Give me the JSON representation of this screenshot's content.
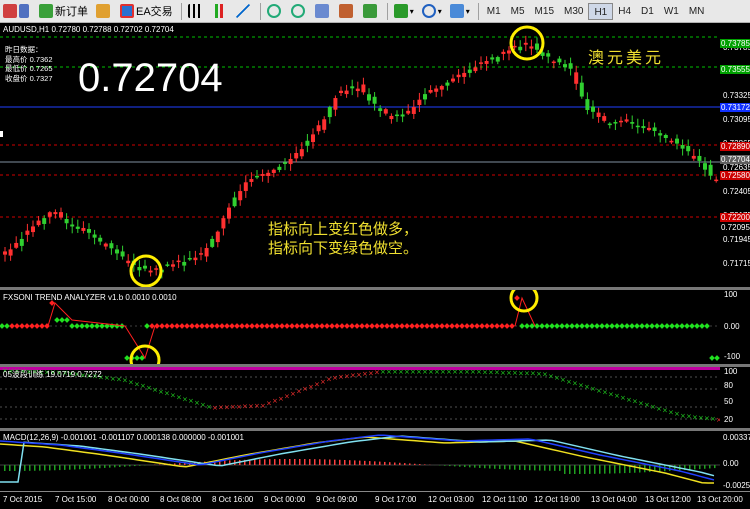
{
  "toolbar": {
    "new_order": "新订单",
    "ea": "EA交易",
    "timeframes": [
      "M1",
      "M5",
      "M15",
      "M30",
      "H1",
      "H4",
      "D1",
      "W1",
      "MN"
    ],
    "active_tf": "H1"
  },
  "chart": {
    "header": "AUDUSD,H1  0.72780 0.72788 0.72702 0.72704",
    "big_price": "0.72704",
    "info": [
      "昨日数据：",
      "最高价 0.7362",
      "最低价 0.7265",
      "收盘价 0.7327"
    ],
    "label_cn": "澳元美元",
    "annotation": [
      "指标向上变红色做多，",
      "指标向下变绿色做空。"
    ],
    "price_ticks": [
      "0.73785",
      "0.73555",
      "0.73325",
      "0.73095",
      "0.72865",
      "0.72635",
      "0.72405",
      "0.72175",
      "0.71945",
      "0.71715"
    ],
    "tags": [
      {
        "text": "0.73785",
        "color": "#00a000"
      },
      {
        "text": "0.73555",
        "color": "#00a000"
      },
      {
        "text": "0.73172",
        "color": "#1030ff"
      },
      {
        "text": "0.72890",
        "color": "#cc0000"
      },
      {
        "text": "0.72704",
        "color": "#606060"
      },
      {
        "text": "0.72580",
        "color": "#cc0000"
      },
      {
        "text": "0.72200",
        "color": "#cc0000"
      },
      {
        "text": "0.72095",
        "color": "#000000"
      }
    ]
  },
  "trend": {
    "label": "FXSONI TREND ANALYZER v1.b 0.0010 0.0010",
    "ticks": [
      "100",
      "0.00",
      "-100"
    ]
  },
  "osc": {
    "label": "05波段训练 19.0719 0.7272",
    "ticks": [
      "100",
      "80",
      "50",
      "20"
    ]
  },
  "macd": {
    "label": "MACD(12,26,9) -0.001001 -0.001107 0.000138 0.000000 -0.001001",
    "ticks": [
      "0.00337",
      "0.00",
      "-0.0025"
    ]
  },
  "time_axis": [
    "7 Oct 2015",
    "7 Oct 15:00",
    "8 Oct 00:00",
    "8 Oct 08:00",
    "8 Oct 16:00",
    "9 Oct 00:00",
    "9 Oct 09:00",
    "9 Oct 17:00",
    "12 Oct 03:00",
    "12 Oct 11:00",
    "12 Oct 19:00",
    "13 Oct 04:00",
    "13 Oct 12:00",
    "13 Oct 20:00"
  ]
}
